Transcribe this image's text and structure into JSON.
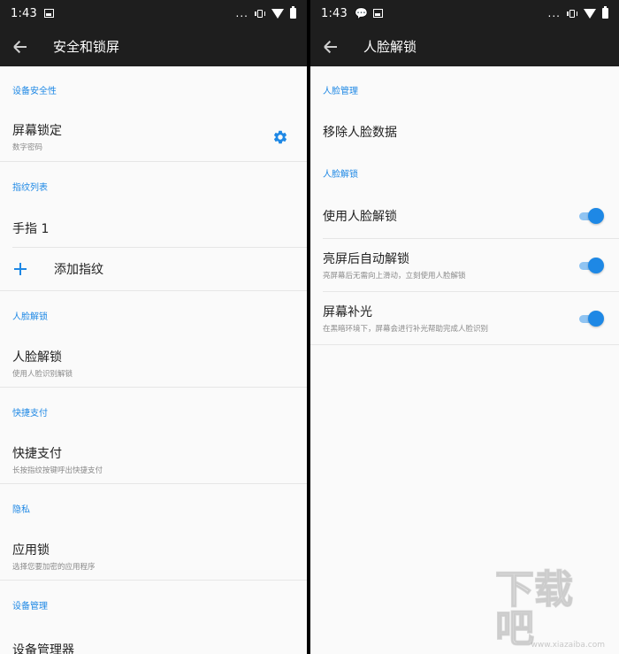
{
  "left": {
    "statusbar": {
      "time": "1:43",
      "dots": "..."
    },
    "appbar": {
      "title": "安全和锁屏"
    },
    "sections": {
      "device_security": {
        "header": "设备安全性",
        "screen_lock": {
          "title": "屏幕锁定",
          "subtitle": "数字密码"
        }
      },
      "fingerprints": {
        "header": "指纹列表",
        "finger1": "手指 1",
        "add": "添加指纹"
      },
      "face": {
        "header": "人脸解锁",
        "item": {
          "title": "人脸解锁",
          "subtitle": "使用人脸识别解锁"
        }
      },
      "quick_pay": {
        "header": "快捷支付",
        "item": {
          "title": "快捷支付",
          "subtitle": "长按指纹按键呼出快捷支付"
        }
      },
      "privacy": {
        "header": "隐私",
        "item": {
          "title": "应用锁",
          "subtitle": "选择您要加密的应用程序"
        }
      },
      "device_admin": {
        "header": "设备管理",
        "item": {
          "title": "设备管理器"
        }
      }
    }
  },
  "right": {
    "statusbar": {
      "time": "1:43",
      "dots": "..."
    },
    "appbar": {
      "title": "人脸解锁"
    },
    "face_manage": {
      "header": "人脸管理",
      "remove": "移除人脸数据"
    },
    "face_unlock": {
      "header": "人脸解锁",
      "items": [
        {
          "title": "使用人脸解锁",
          "subtitle": "",
          "enabled": true
        },
        {
          "title": "亮屏后自动解锁",
          "subtitle": "亮屏幕后无需向上滑动，立刻使用人脸解锁",
          "enabled": true
        },
        {
          "title": "屏幕补光",
          "subtitle": "在黑暗环境下，屏幕会进行补光帮助完成人脸识别",
          "enabled": true
        }
      ]
    },
    "watermark": {
      "text": "下载吧",
      "url": "www.xiazaiba.com"
    }
  },
  "colors": {
    "accent": "#1e88e5",
    "bar": "#1e1e1e",
    "background": "#fafafa"
  }
}
